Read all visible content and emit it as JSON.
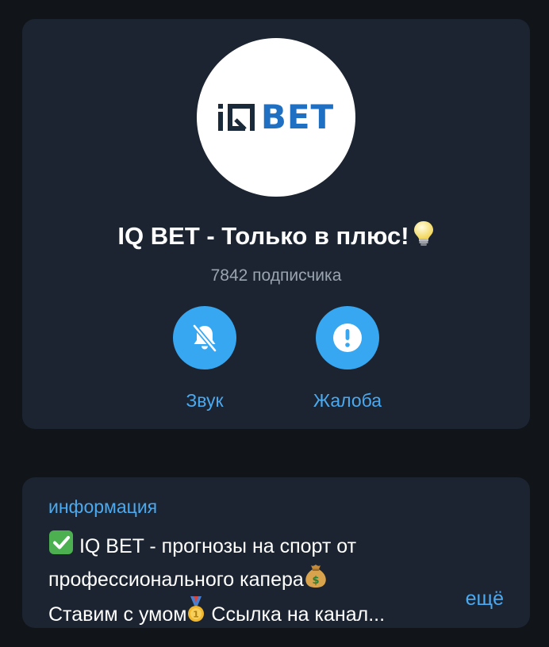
{
  "channel": {
    "avatar_logo_text": "BET",
    "title": "IQ BET - Только в плюс!",
    "title_emoji": "light-bulb",
    "subscribers": "7842 подписчика"
  },
  "actions": [
    {
      "label": "Звук",
      "icon": "bell-muted-icon"
    },
    {
      "label": "Жалоба",
      "icon": "exclamation-icon"
    }
  ],
  "info": {
    "header": "информация",
    "line1_text": "IQ BET - прогнозы на спорт от",
    "line1_emoji": "check-mark-button",
    "line2_text": "профессионального капера",
    "line2_emoji": "money-bag",
    "line3_text_a": "Ставим с умом",
    "line3_emoji": "medal",
    "line3_text_b": "Ссылка на канал...",
    "more": "ещё"
  },
  "colors": {
    "background": "#111419",
    "card": "#1b2430",
    "accent": "#37a7f2",
    "link": "#4ba9f0",
    "muted": "#9aa4b0",
    "logo_blue": "#1f6fc2"
  }
}
